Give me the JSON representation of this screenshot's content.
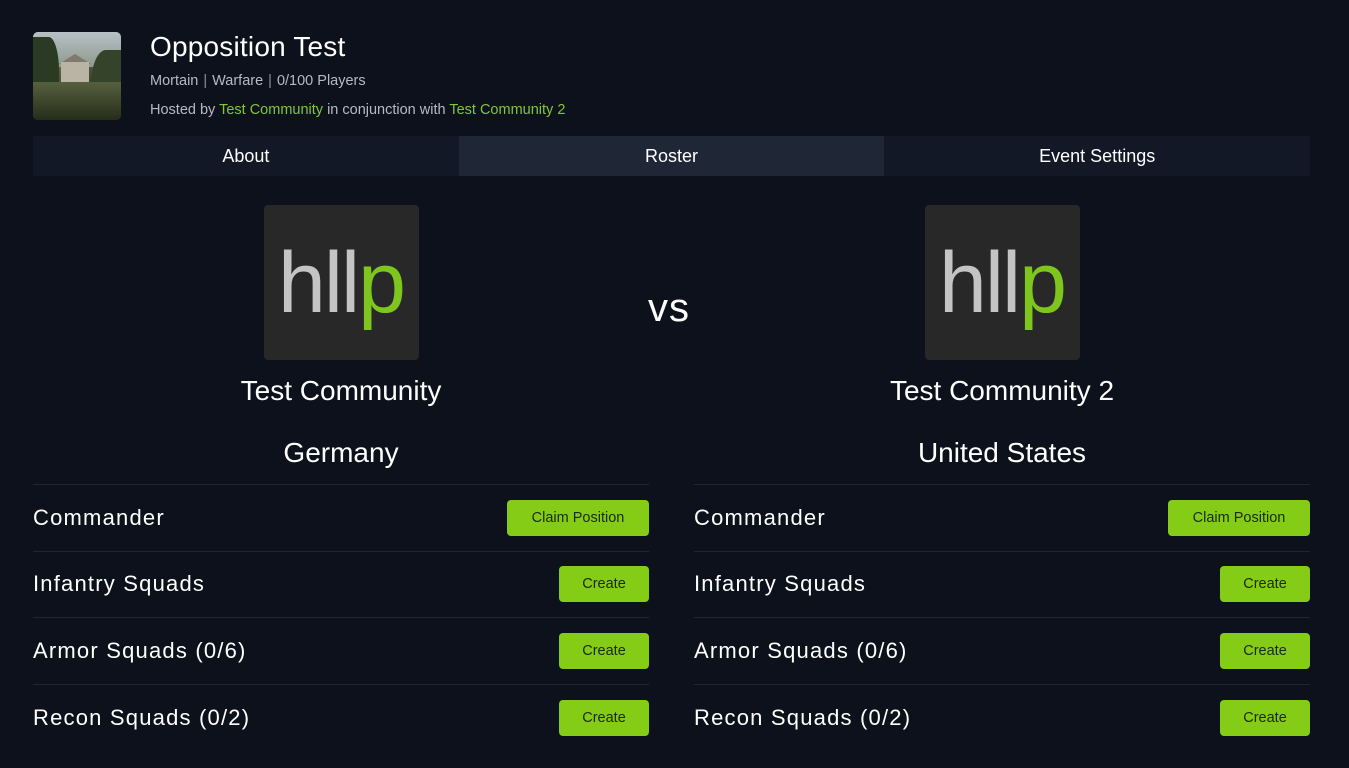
{
  "event": {
    "title": "Opposition Test",
    "map": "Mortain",
    "mode": "Warfare",
    "players": "0/100 Players",
    "separator": "|",
    "hosted_prefix": "Hosted by",
    "host": "Test Community",
    "conjunction_text": "in conjunction with",
    "co_host": "Test Community 2"
  },
  "tabs": [
    {
      "label": "About",
      "active": false
    },
    {
      "label": "Roster",
      "active": true
    },
    {
      "label": "Event Settings",
      "active": false
    }
  ],
  "vs_label": "vs",
  "teams": [
    {
      "logo_text_gray": "hll",
      "logo_text_green": "p",
      "community": "Test Community",
      "faction": "Germany",
      "roles": [
        {
          "label": "Commander",
          "button": "Claim Position"
        },
        {
          "label": "Infantry Squads",
          "button": "Create"
        },
        {
          "label": "Armor Squads (0/6)",
          "button": "Create"
        },
        {
          "label": "Recon Squads (0/2)",
          "button": "Create"
        }
      ]
    },
    {
      "logo_text_gray": "hll",
      "logo_text_green": "p",
      "community": "Test Community 2",
      "faction": "United States",
      "roles": [
        {
          "label": "Commander",
          "button": "Claim Position"
        },
        {
          "label": "Infantry Squads",
          "button": "Create"
        },
        {
          "label": "Armor Squads (0/6)",
          "button": "Create"
        },
        {
          "label": "Recon Squads (0/2)",
          "button": "Create"
        }
      ]
    }
  ],
  "colors": {
    "background": "#0d111b",
    "accent_green": "#84cc16",
    "link_green": "#7ec83a",
    "tab_bg": "#121826",
    "tab_active_bg": "#1f2736"
  }
}
